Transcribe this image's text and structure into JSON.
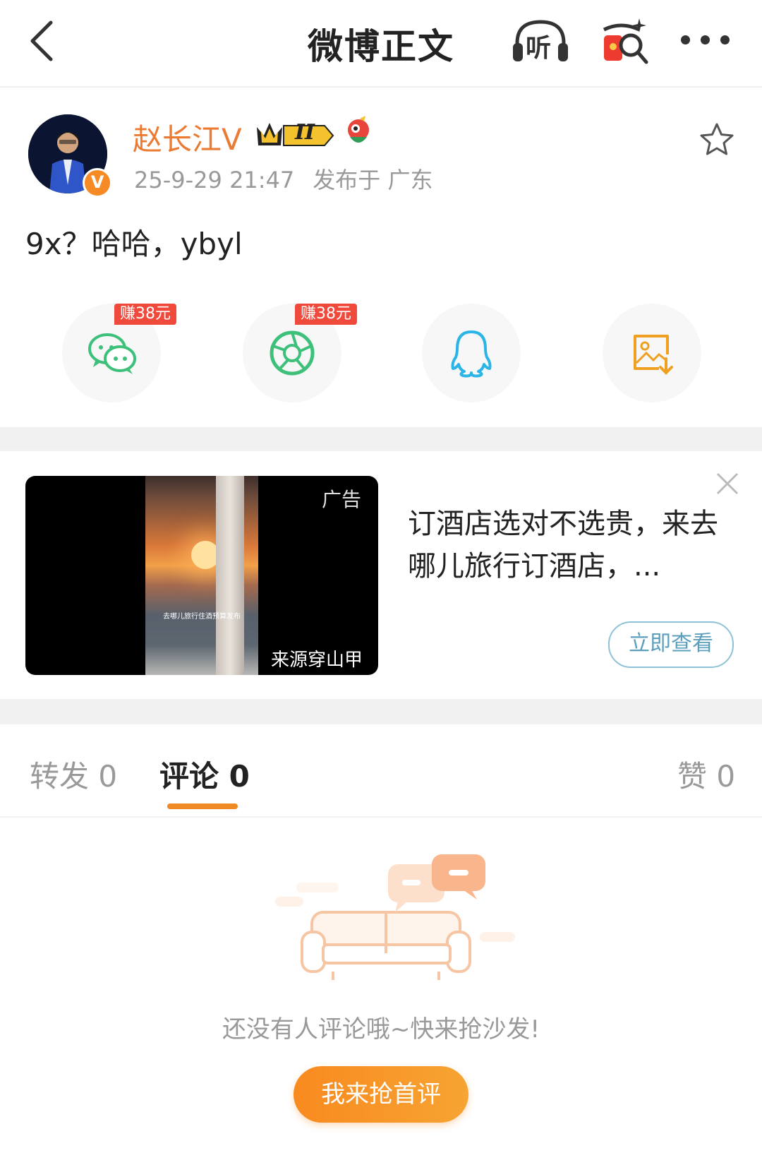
{
  "header": {
    "title": "微博正文",
    "listen_label": "听"
  },
  "post": {
    "username": "赵长江V",
    "level_badge": "II",
    "verified_badge": "V",
    "time": "25-9-29 21:47",
    "location": "发布于 广东",
    "content": "9x？哈哈，ybyl"
  },
  "share": {
    "earn_wechat": "赚38元",
    "earn_moments": "赚38元",
    "icons": [
      "wechat-icon",
      "moments-icon",
      "qq-icon",
      "save-image-icon"
    ]
  },
  "ad": {
    "label": "广告",
    "source": "来源穿山甲",
    "image_caption": "去哪儿旅行住酒预算发布",
    "text": "订酒店选对不选贵，来去哪儿旅行订酒店，...",
    "button": "立即查看"
  },
  "tabs": {
    "repost": "转发 0",
    "comment": "评论 0",
    "like": "赞 0"
  },
  "empty": {
    "message": "还没有人评论哦~快来抢沙发!",
    "button": "我来抢首评"
  },
  "colors": {
    "accent": "#f08a25",
    "username": "#eb7a32",
    "earn_badge": "#ef4a3b",
    "wechat": "#3dc07a",
    "qq": "#2bb5e6",
    "save": "#f0a020"
  }
}
